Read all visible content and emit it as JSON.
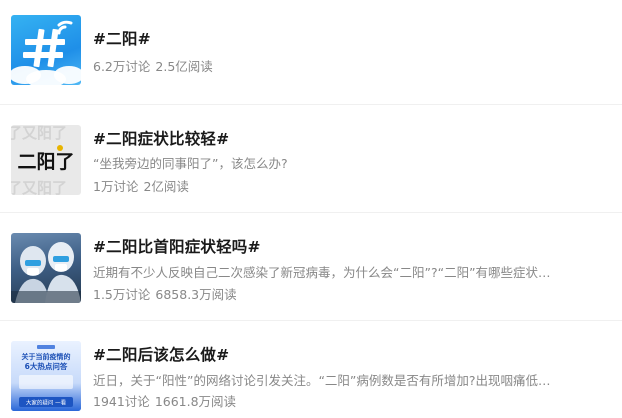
{
  "topics": [
    {
      "title": "#二阳#",
      "description": "",
      "discussions": "6.2万讨论",
      "reads": "2.5亿阅读",
      "thumb_icon": "hashtag-icon"
    },
    {
      "title": "#二阳症状比较轻#",
      "description": "“坐我旁边的同事阳了”，该怎么办?",
      "discussions": "1万讨论",
      "reads": "2亿阅读",
      "thumb_text": "二阳了",
      "thumb_bg_text": "了又阳了又阳了又阳了"
    },
    {
      "title": "#二阳比首阳症状轻吗#",
      "description": "近期有不少人反映自己二次感染了新冠病毒，为什么会“二阳”?“二阳”有哪些症状，如...",
      "discussions": "1.5万讨论",
      "reads": "6858.3万阅读",
      "thumb_icon": "medical-workers-photo"
    },
    {
      "title": "#二阳后该怎么做#",
      "description": "近日，关于“阳性”的网络讨论引发关注。“二阳”病例数是否有所增加?出现咽痛低烧等...",
      "discussions": "1941讨论",
      "reads": "1661.8万阅读",
      "thumb_lines": [
        "关于当前疫情的",
        "6大热点问答",
        "大家的疑问 一看"
      ]
    }
  ],
  "colors": {
    "title": "#1a1a1a",
    "meta": "#888888",
    "divider": "#f0f0f0",
    "accent_blue": "#1f8fe8"
  }
}
